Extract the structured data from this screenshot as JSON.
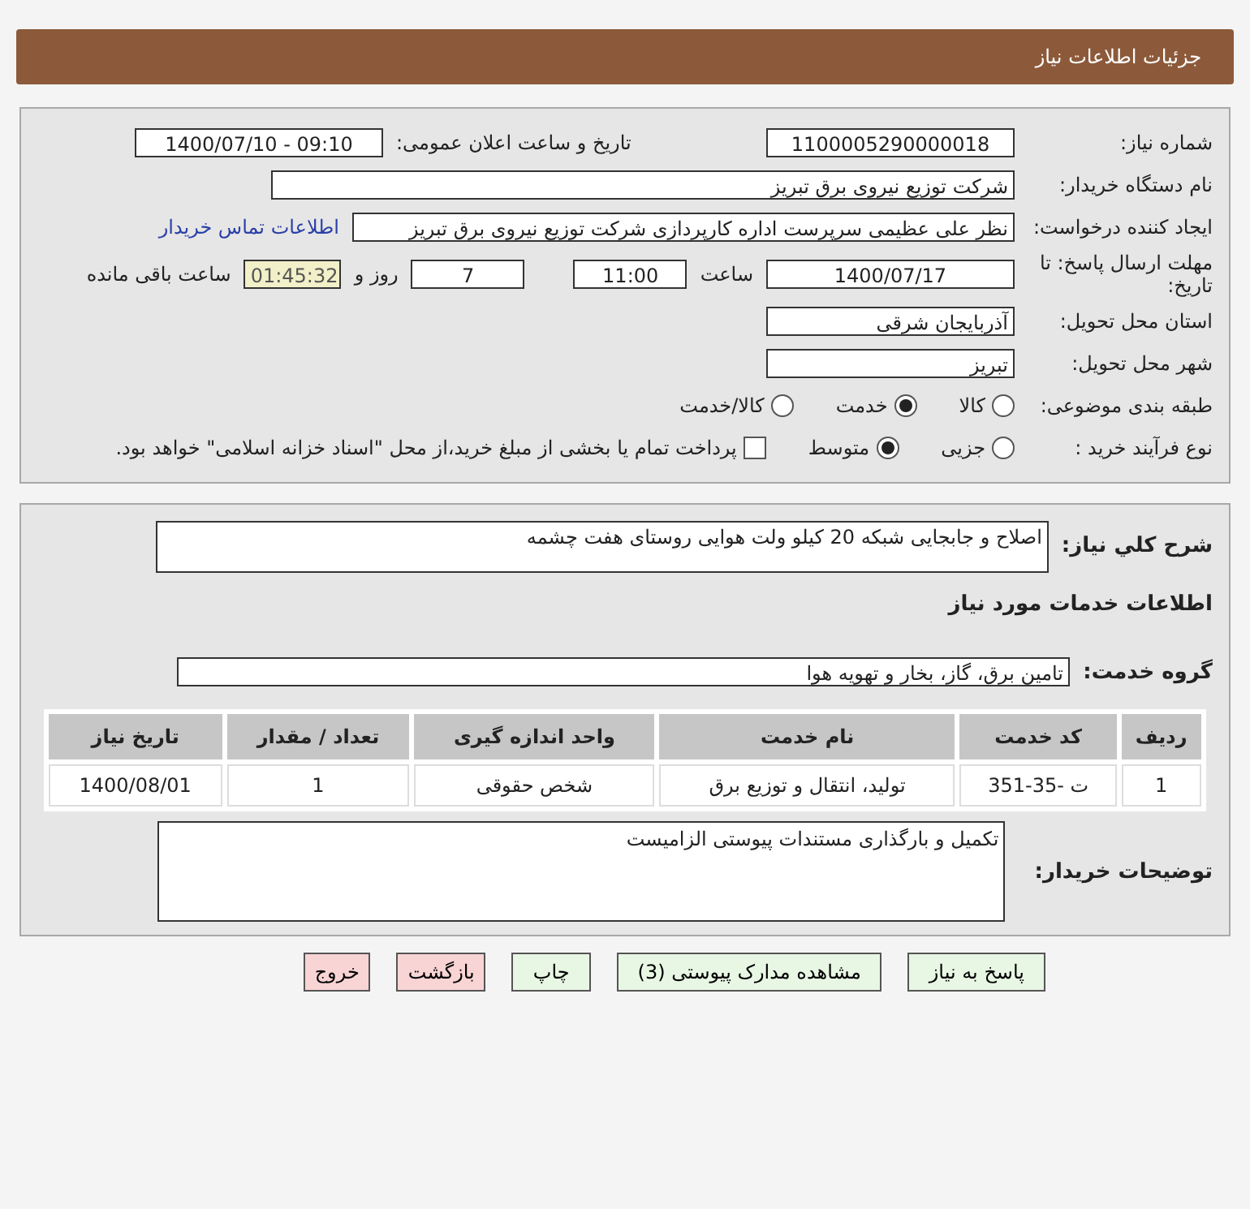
{
  "header": {
    "title": "جزئیات اطلاعات نیاز"
  },
  "details": {
    "need_number": {
      "label": "شماره نیاز:",
      "value": "1100005290000018"
    },
    "announce": {
      "label": "تاریخ و ساعت اعلان عمومی:",
      "value": "1400/07/10 - 09:10"
    },
    "buyer": {
      "label": "نام دستگاه خریدار:",
      "value": "شرکت توزیع نیروی برق تبریز"
    },
    "creator": {
      "label": "ایجاد کننده درخواست:",
      "value": "نظر علی عظیمی سرپرست اداره کارپردازی شرکت توزیع نیروی برق تبریز",
      "link": "اطلاعات تماس خریدار"
    },
    "deadline": {
      "label": "مهلت ارسال پاسخ: تا تاریخ:",
      "date": "1400/07/17",
      "time_label": "ساعت",
      "time": "11:00",
      "days": "7",
      "days_label": "روز و",
      "remaining": "01:45:32",
      "remaining_label": "ساعت باقی مانده"
    },
    "province": {
      "label": "استان محل تحویل:",
      "value": "آذربایجان شرقی"
    },
    "city": {
      "label": "شهر محل تحویل:",
      "value": "تبریز"
    },
    "category": {
      "label": "طبقه بندی موضوعی:",
      "options": [
        {
          "label": "کالا",
          "selected": false
        },
        {
          "label": "خدمت",
          "selected": true
        },
        {
          "label": "کالا/خدمت",
          "selected": false
        }
      ]
    },
    "process": {
      "label": "نوع فرآیند خرید :",
      "options": [
        {
          "label": "جزیی",
          "selected": false
        },
        {
          "label": "متوسط",
          "selected": true
        }
      ],
      "checkbox": {
        "label": "پرداخت تمام یا بخشی از مبلغ خرید،از محل \"اسناد خزانه اسلامی\" خواهد بود.",
        "checked": false
      }
    }
  },
  "summary": {
    "description": {
      "label": "شرح کلي نياز:",
      "value": "اصلاح و جابجایی شبکه 20 کیلو ولت هوایی روستای هفت چشمه"
    },
    "services_title": "اطلاعات خدمات مورد نیاز",
    "service_group": {
      "label": "گروه خدمت:",
      "value": "تامین برق، گاز، بخار و تهویه هوا"
    },
    "table": {
      "columns": [
        "ردیف",
        "کد خدمت",
        "نام خدمت",
        "واحد اندازه گیری",
        "تعداد / مقدار",
        "تاریخ نیاز"
      ],
      "rows": [
        [
          "1",
          "ت -35-351",
          "تولید، انتقال و توزیع برق",
          "شخص حقوقی",
          "1",
          "1400/08/01"
        ]
      ]
    },
    "buyer_notes": {
      "label": "توضیحات خریدار:",
      "value": "تکمیل و بارگذاری مستندات پیوستی الزامیست"
    }
  },
  "buttons": [
    {
      "label": "پاسخ به نیاز",
      "kind": "normal"
    },
    {
      "label": "مشاهده مدارک پیوستی (3)",
      "kind": "normal"
    },
    {
      "label": "چاپ",
      "kind": "normal"
    },
    {
      "label": "بازگشت",
      "kind": "danger"
    },
    {
      "label": "خروج",
      "kind": "danger"
    }
  ]
}
